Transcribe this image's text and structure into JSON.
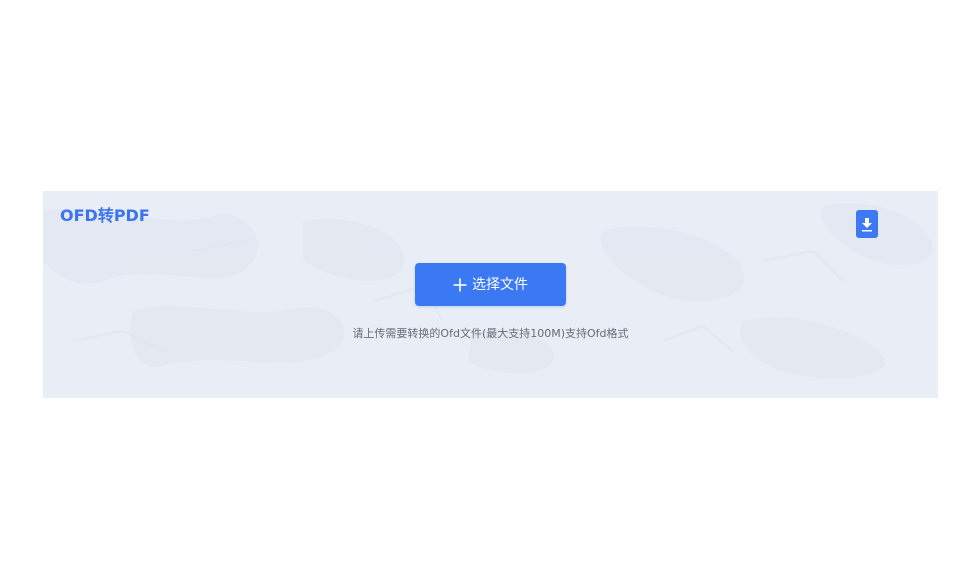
{
  "converter": {
    "title": "OFD转PDF",
    "select_button_label": "选择文件",
    "hint": "请上传需要转换的Ofd文件(最大支持100M)支持Ofd格式",
    "icons": {
      "select": "plus-icon",
      "download": "download-icon"
    },
    "colors": {
      "accent": "#3b78f4",
      "panel_background": "#e9edf5",
      "hint_text": "#666b75"
    }
  }
}
